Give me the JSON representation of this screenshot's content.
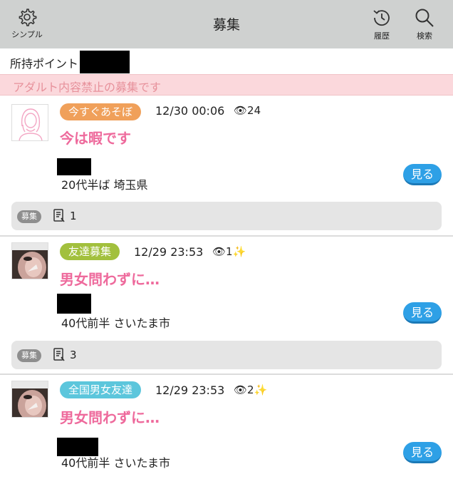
{
  "header": {
    "title": "募集",
    "simple_label": "シンプル",
    "history_label": "履歴",
    "search_label": "検索"
  },
  "points_label": "所持ポイント",
  "notice": "アダルト内容禁止の募集です",
  "posts": [
    {
      "category": "今すぐあそぼ",
      "category_color": "#f0a05a",
      "datetime": "12/30 00:06",
      "views": "24",
      "views_sparkle": "",
      "heading": "今は暇です",
      "profile": "20代半ば 埼玉県",
      "button": "見る",
      "tag": "募集",
      "count": "1"
    },
    {
      "category": "友達募集",
      "category_color": "#a2c03d",
      "datetime": "12/29 23:53",
      "views": "1",
      "views_sparkle": "✨",
      "heading": "男女問わずに…",
      "profile": "40代前半 さいたま市",
      "button": "見る",
      "tag": "募集",
      "count": "3"
    },
    {
      "category": "全国男女友達",
      "category_color": "#5cc6dc",
      "datetime": "12/29 23:53",
      "views": "2",
      "views_sparkle": "✨",
      "heading": "男女問わずに…",
      "profile": "40代前半 さいたま市",
      "button": "見る"
    }
  ]
}
